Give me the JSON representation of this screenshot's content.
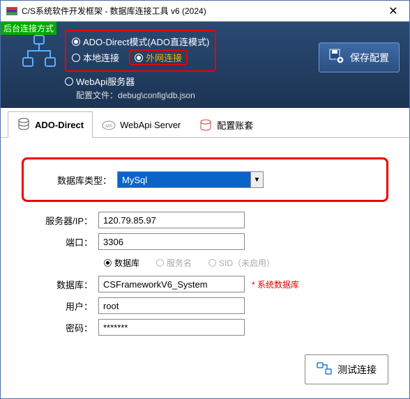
{
  "window": {
    "title": "C/S系统软件开发框架 - 数据库连接工具 v6 (2024)"
  },
  "top": {
    "tag": "后台连接方式",
    "mode_ado": "ADO-Direct模式(ADO直连模式)",
    "mode_local": "本地连接",
    "mode_remote": "外网连接",
    "mode_webapi": "WebApi服务器",
    "config_label": "配置文件：",
    "config_path": "debug\\config\\db.json",
    "save_btn": "保存配置"
  },
  "tabs": {
    "t1": "ADO-Direct",
    "t2": "WebApi Server",
    "t3": "配置账套"
  },
  "form": {
    "dbtype_label": "数据库类型：",
    "dbtype_value": "MySql",
    "server_label": "服务器/IP：",
    "server_value": "120.79.85.97",
    "port_label": "端口：",
    "port_value": "3306",
    "opt_db": "数据库",
    "opt_svc": "服务名",
    "opt_sid": "SID（未启用）",
    "dbname_label": "数据库：",
    "dbname_value": "CSFrameworkV6_System",
    "dbname_note": "* 系统数据库",
    "user_label": "用户：",
    "user_value": "root",
    "pwd_label": "密码：",
    "pwd_value": "*******"
  },
  "bottom": {
    "test_btn": "测试连接"
  }
}
